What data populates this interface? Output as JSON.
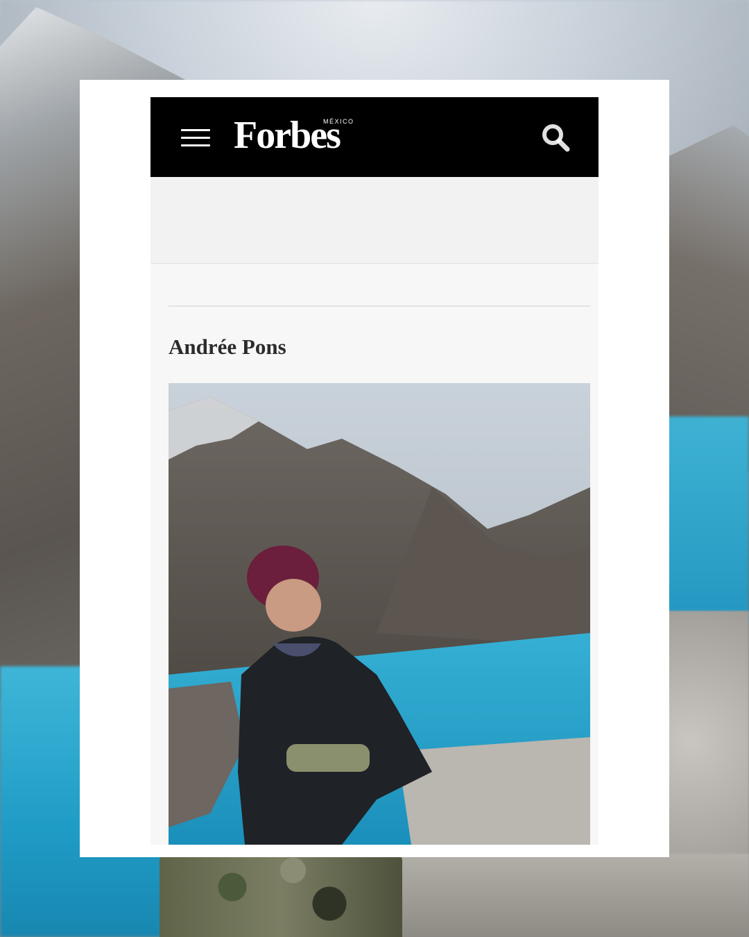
{
  "header": {
    "menu_icon": "hamburger-menu-icon",
    "logo_text": "Forbes",
    "logo_region": "MÉXICO",
    "search_icon": "search-icon",
    "background_color": "#000000"
  },
  "article": {
    "author_name": "Andrée Pons",
    "photo_icon": "author-photo"
  },
  "colors": {
    "card": "#ffffff",
    "page": "#f7f7f7",
    "ad_slot": "#f2f2f2",
    "lake": "#1f9cc6"
  }
}
